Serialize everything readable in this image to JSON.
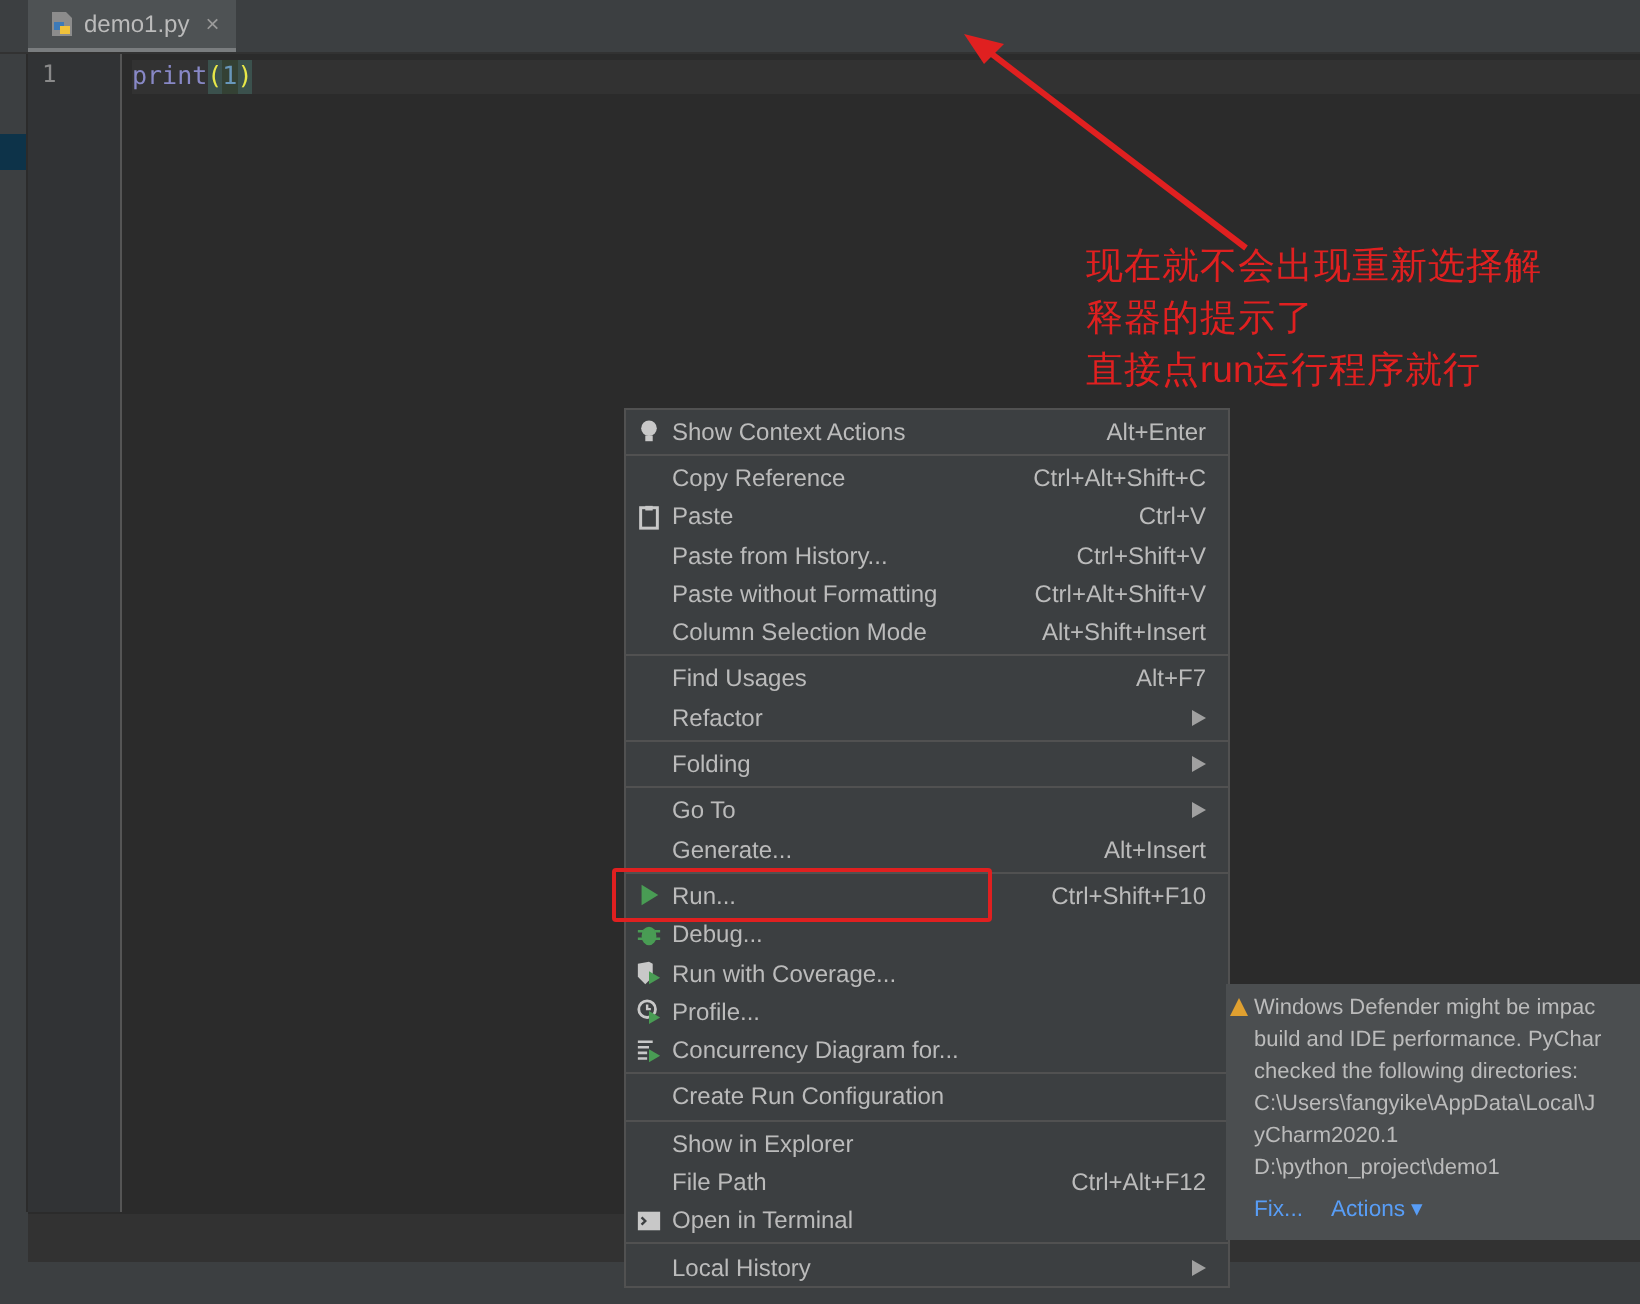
{
  "tabs": [
    {
      "label": "demo1.py",
      "close": "×",
      "selected": true
    }
  ],
  "editor": {
    "lines": [
      {
        "number": "1",
        "tokens": [
          {
            "kind": "builtin",
            "text": "print"
          },
          {
            "kind": "paren",
            "text": "("
          },
          {
            "kind": "number",
            "text": "1"
          },
          {
            "kind": "paren",
            "text": ")"
          }
        ]
      }
    ]
  },
  "context_menu": {
    "groups": [
      [
        {
          "label": "Show Context Actions",
          "shortcut": "Alt+Enter",
          "kind": "bulb"
        }
      ],
      [
        {
          "label": "Copy Reference",
          "shortcut": "Ctrl+Alt+Shift+C"
        },
        {
          "label": "Paste",
          "shortcut": "Ctrl+V",
          "kind": "clipboard"
        },
        {
          "label": "Paste from History...",
          "shortcut": "Ctrl+Shift+V"
        },
        {
          "label": "Paste without Formatting",
          "shortcut": "Ctrl+Alt+Shift+V"
        },
        {
          "label": "Column Selection Mode",
          "shortcut": "Alt+Shift+Insert"
        }
      ],
      [
        {
          "label": "Find Usages",
          "shortcut": "Alt+F7"
        },
        {
          "label": "Refactor",
          "submenu": true
        }
      ],
      [
        {
          "label": "Folding",
          "submenu": true
        }
      ],
      [
        {
          "label": "Go To",
          "submenu": true
        },
        {
          "label": "Generate...",
          "shortcut": "Alt+Insert"
        }
      ],
      [
        {
          "label": "Run...",
          "shortcut": "Ctrl+Shift+F10",
          "kind": "run",
          "highlighted": true
        },
        {
          "label": "Debug...",
          "kind": "bug"
        },
        {
          "label": "Run with Coverage...",
          "kind": "coverage"
        },
        {
          "label": "Profile...",
          "kind": "profile"
        },
        {
          "label": "Concurrency Diagram for...",
          "kind": "concurrency"
        }
      ],
      [
        {
          "label": "Create Run Configuration"
        }
      ],
      [
        {
          "label": "Show in Explorer"
        },
        {
          "label": "File Path",
          "shortcut": "Ctrl+Alt+F12"
        },
        {
          "label": "Open in Terminal",
          "kind": "terminal"
        }
      ],
      [
        {
          "label": "Local History",
          "submenu": true
        }
      ]
    ]
  },
  "notification": {
    "lines": [
      "Windows Defender might be impac",
      "build and IDE performance. PyChar",
      "checked the following directories:",
      "C:\\Users\\fangyike\\AppData\\Local\\J",
      "yCharm2020.1",
      "D:\\python_project\\demo1"
    ],
    "actions": [
      {
        "label": "Fix..."
      },
      {
        "label": "Actions ▾"
      }
    ]
  },
  "annotation": {
    "lines": [
      "现在就不会出现重新选择解",
      "释器的提示了",
      "直接点run运行程序就行"
    ]
  }
}
